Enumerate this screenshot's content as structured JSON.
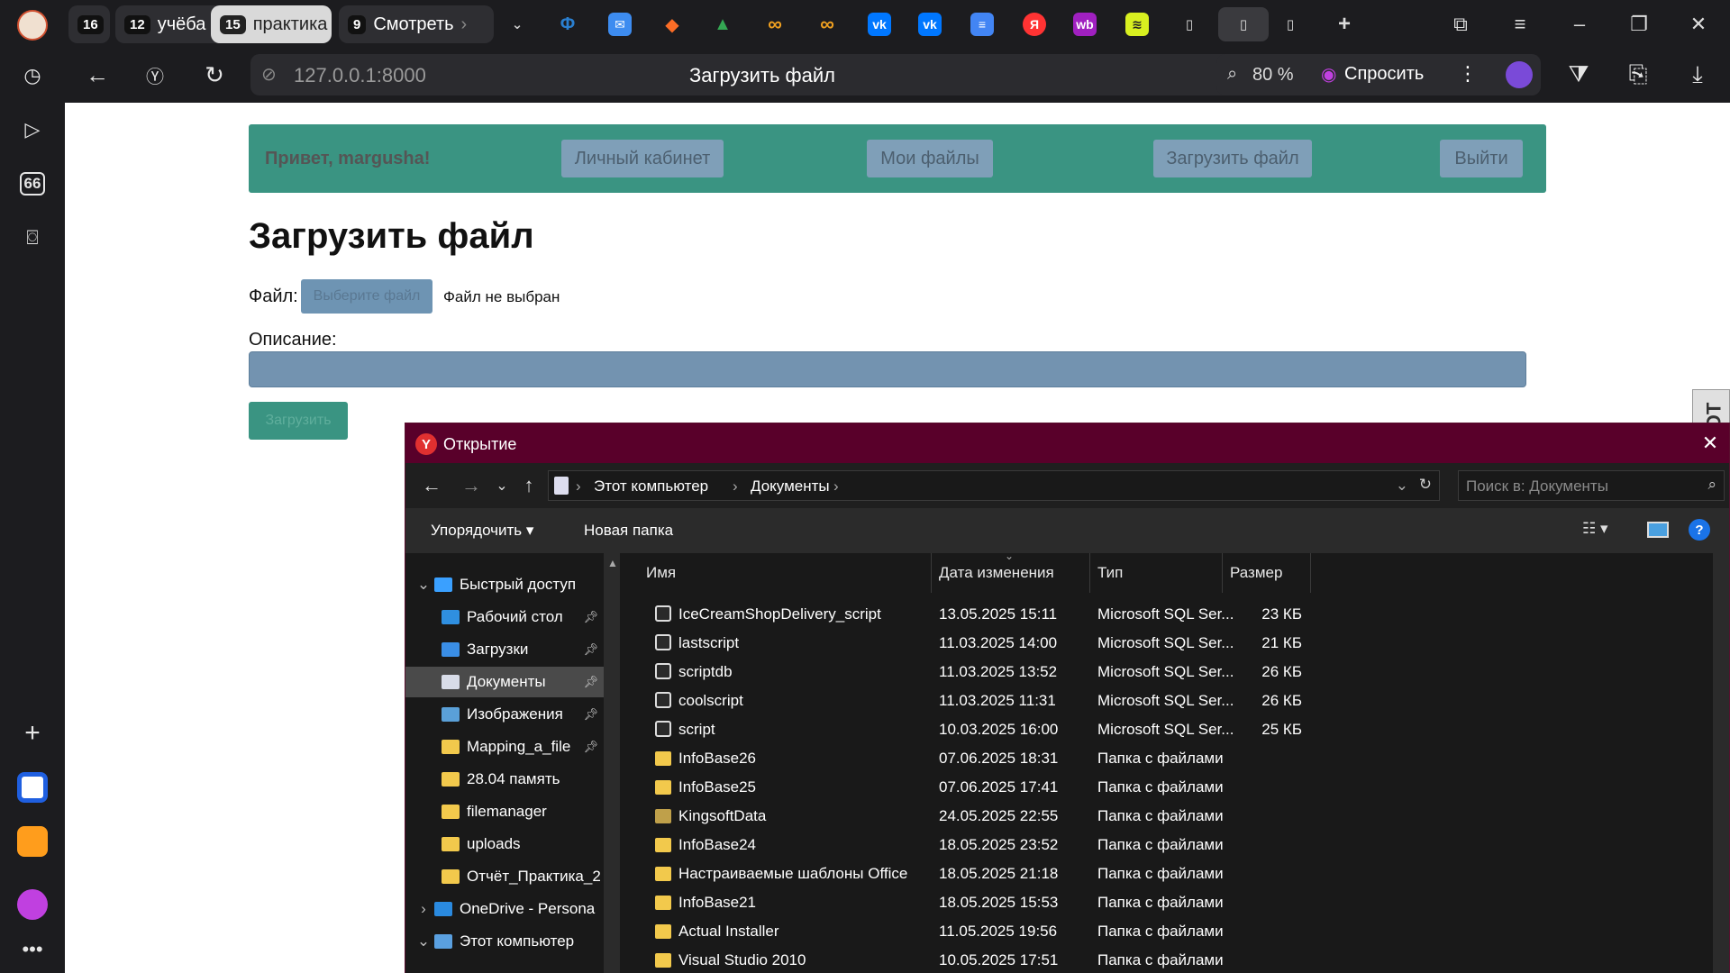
{
  "browser": {
    "tabs": [
      {
        "count": "16",
        "label": ""
      },
      {
        "count": "12",
        "label": "учёба"
      },
      {
        "count": "15",
        "label": "практика",
        "active": true
      },
      {
        "count": "9",
        "label": "Смотреть"
      }
    ],
    "address": "127.0.0.1:8000",
    "page_title": "Загрузить файл",
    "zoom": "80 %",
    "ask_label": "Спросить",
    "rail_badge": "66"
  },
  "page": {
    "greeting": "Привет, margusha!",
    "nav": [
      "Личный кабинет",
      "Мои файлы",
      "Загрузить файл",
      "Выйти"
    ],
    "heading": "Загрузить файл",
    "file_label": "Файл:",
    "choose_button": "Выберите файл",
    "no_file_text": "Файл не выбран",
    "description_label": "Описание:",
    "upload_button": "Загрузить",
    "side_widget_text": "ОТ"
  },
  "dialog": {
    "title": "Открытие",
    "breadcrumb": [
      "Этот компьютер",
      "Документы"
    ],
    "search_placeholder": "Поиск в: Документы",
    "organize_label": "Упорядочить",
    "new_folder_label": "Новая папка",
    "tree": [
      {
        "label": "Быстрый доступ",
        "icon": "star-icon",
        "level": 0,
        "expanded": true
      },
      {
        "label": "Рабочий стол",
        "icon": "desktop-icon",
        "level": 1,
        "pinned": true
      },
      {
        "label": "Загрузки",
        "icon": "download-icon",
        "level": 1,
        "pinned": true
      },
      {
        "label": "Документы",
        "icon": "documents-icon",
        "level": 1,
        "pinned": true,
        "selected": true
      },
      {
        "label": "Изображения",
        "icon": "images-icon",
        "level": 1,
        "pinned": true
      },
      {
        "label": "Mapping_a_file",
        "icon": "folder-icon",
        "level": 1,
        "pinned": true
      },
      {
        "label": "28.04 память",
        "icon": "folder-icon",
        "level": 1
      },
      {
        "label": "filemanager",
        "icon": "folder-icon",
        "level": 1
      },
      {
        "label": "uploads",
        "icon": "folder-icon",
        "level": 1
      },
      {
        "label": "Отчёт_Практика_2",
        "icon": "folder-icon",
        "level": 1
      },
      {
        "label": "OneDrive - Persona",
        "icon": "cloud-icon",
        "level": 0
      },
      {
        "label": "Этот компьютер",
        "icon": "computer-icon",
        "level": 0,
        "expanded": true
      }
    ],
    "columns": [
      "Имя",
      "Дата изменения",
      "Тип",
      "Размер"
    ],
    "files": [
      {
        "name": "IceCreamShopDelivery_script",
        "date": "13.05.2025 15:11",
        "type": "Microsoft SQL Ser...",
        "size": "23 КБ",
        "kind": "script"
      },
      {
        "name": "lastscript",
        "date": "11.03.2025 14:00",
        "type": "Microsoft SQL Ser...",
        "size": "21 КБ",
        "kind": "script"
      },
      {
        "name": "scriptdb",
        "date": "11.03.2025 13:52",
        "type": "Microsoft SQL Ser...",
        "size": "26 КБ",
        "kind": "script"
      },
      {
        "name": "coolscript",
        "date": "11.03.2025 11:31",
        "type": "Microsoft SQL Ser...",
        "size": "26 КБ",
        "kind": "script"
      },
      {
        "name": "script",
        "date": "10.03.2025 16:00",
        "type": "Microsoft SQL Ser...",
        "size": "25 КБ",
        "kind": "script"
      },
      {
        "name": "InfoBase26",
        "date": "07.06.2025 18:31",
        "type": "Папка с файлами",
        "size": "",
        "kind": "folder"
      },
      {
        "name": "InfoBase25",
        "date": "07.06.2025 17:41",
        "type": "Папка с файлами",
        "size": "",
        "kind": "folder"
      },
      {
        "name": "KingsoftData",
        "date": "24.05.2025 22:55",
        "type": "Папка с файлами",
        "size": "",
        "kind": "folder-dim"
      },
      {
        "name": "InfoBase24",
        "date": "18.05.2025 23:52",
        "type": "Папка с файлами",
        "size": "",
        "kind": "folder"
      },
      {
        "name": "Настраиваемые шаблоны Office",
        "date": "18.05.2025 21:18",
        "type": "Папка с файлами",
        "size": "",
        "kind": "folder"
      },
      {
        "name": "InfoBase21",
        "date": "18.05.2025 15:53",
        "type": "Папка с файлами",
        "size": "",
        "kind": "folder"
      },
      {
        "name": "Actual Installer",
        "date": "11.05.2025 19:56",
        "type": "Папка с файлами",
        "size": "",
        "kind": "folder"
      },
      {
        "name": "Visual Studio 2010",
        "date": "10.05.2025 17:51",
        "type": "Папка с файлами",
        "size": "",
        "kind": "folder"
      }
    ]
  }
}
